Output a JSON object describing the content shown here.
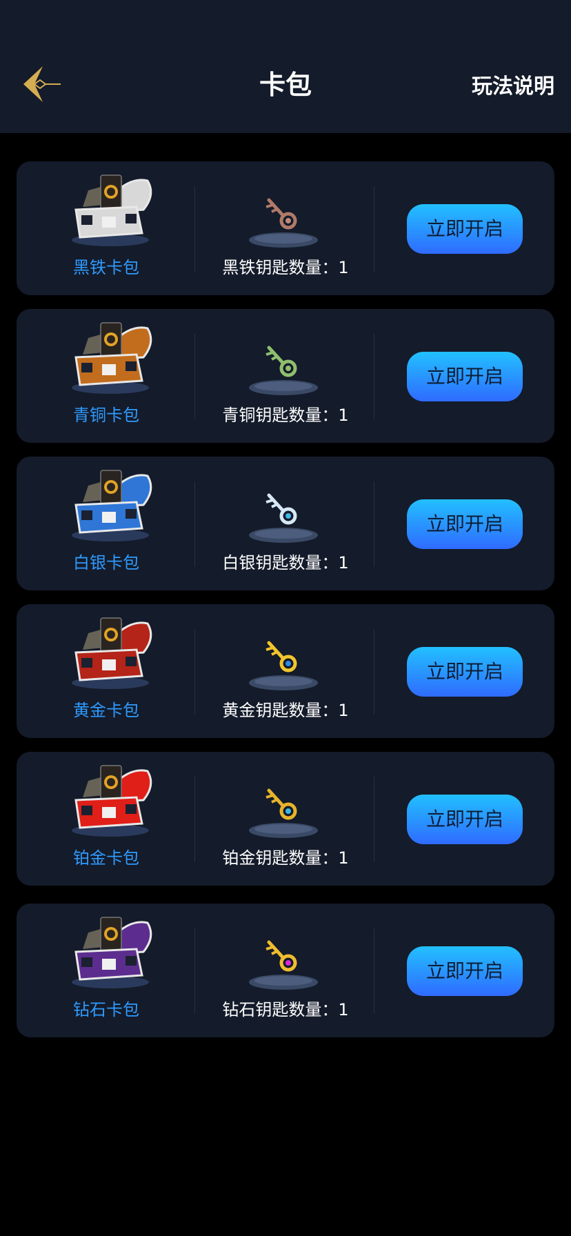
{
  "header": {
    "title": "卡包",
    "rules_link": "玩法说明",
    "back_icon": "back-arrow-icon"
  },
  "colors": {
    "page_bg": "#000000",
    "card_bg": "#141b2a",
    "pack_name": "#2f9bff",
    "button_top": "#22c0ff",
    "button_bottom": "#2f6bff",
    "back_arrow": "#d5ad52"
  },
  "packs": [
    {
      "name": "黑铁卡包",
      "key_label": "黑铁钥匙数量：",
      "key_count": "1",
      "button": "立即开启",
      "chest_color": "#d8d8d8",
      "key_color": "#b07a68",
      "gem_color": "#c08a78"
    },
    {
      "name": "青铜卡包",
      "key_label": "青铜钥匙数量：",
      "key_count": "1",
      "button": "立即开启",
      "chest_color": "#c26d1e",
      "key_color": "#8fbf6e",
      "gem_color": "#8fbf6e"
    },
    {
      "name": "白银卡包",
      "key_label": "白银钥匙数量：",
      "key_count": "1",
      "button": "立即开启",
      "chest_color": "#2f76d6",
      "key_color": "#d6e7f5",
      "gem_color": "#43b6e8"
    },
    {
      "name": "黄金卡包",
      "key_label": "黄金钥匙数量：",
      "key_count": "1",
      "button": "立即开启",
      "chest_color": "#b52418",
      "key_color": "#f2c52c",
      "gem_color": "#2f8ae3"
    },
    {
      "name": "铂金卡包",
      "key_label": "铂金钥匙数量：",
      "key_count": "1",
      "button": "立即开启",
      "chest_color": "#e01f18",
      "key_color": "#e7b32a",
      "gem_color": "#39b8e6"
    },
    {
      "name": "钻石卡包",
      "key_label": "钻石钥匙数量：",
      "key_count": "1",
      "button": "立即开启",
      "chest_color": "#5c2d8f",
      "key_color": "#f0bd2f",
      "gem_color": "#d62ad6"
    }
  ]
}
